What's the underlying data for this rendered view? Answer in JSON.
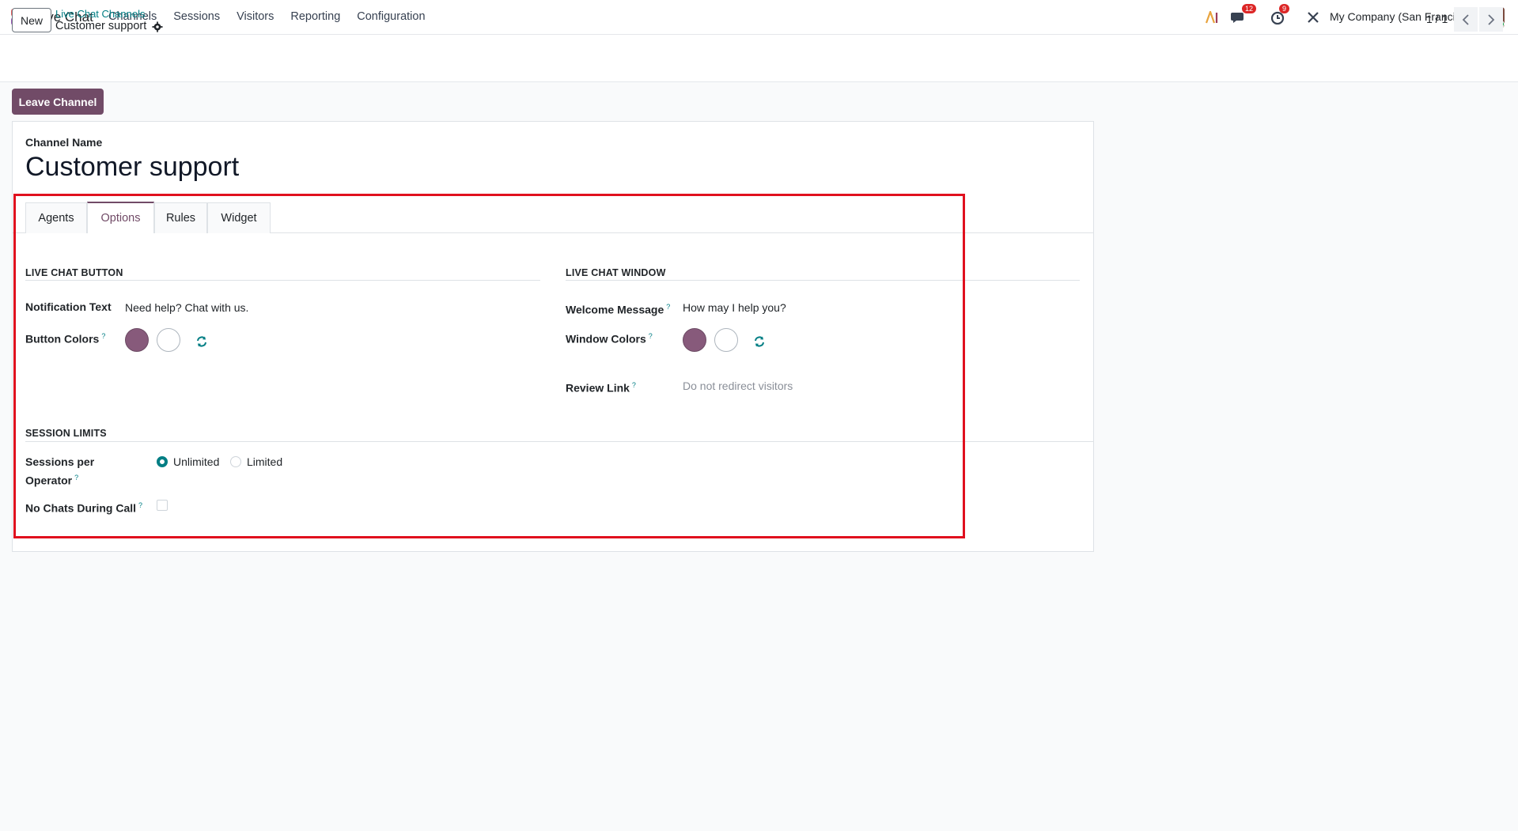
{
  "navbar": {
    "app_name": "Live Chat",
    "menu": [
      "Channels",
      "Sessions",
      "Visitors",
      "Reporting",
      "Configuration"
    ],
    "messages_badge": "12",
    "activities_badge": "9",
    "company": "My Company (San Francisco)"
  },
  "control": {
    "new_label": "New",
    "breadcrumb": "Live Chat Channels",
    "record_title": "Customer support",
    "pager": "1 / 1"
  },
  "actions": {
    "leave_label": "Leave Channel"
  },
  "form": {
    "channel_name_label": "Channel Name",
    "channel_name": "Customer support",
    "tabs": [
      "Agents",
      "Options",
      "Rules",
      "Widget"
    ],
    "active_tab": "Options",
    "button_section": {
      "title": "LIVE CHAT BUTTON",
      "notification_label": "Notification Text",
      "notification_value": "Need help? Chat with us.",
      "colors_label": "Button Colors",
      "help_mark": "?"
    },
    "window_section": {
      "title": "LIVE CHAT WINDOW",
      "welcome_label": "Welcome Message",
      "welcome_value": "How may I help you?",
      "colors_label": "Window Colors",
      "review_label": "Review Link",
      "review_placeholder": "Do not redirect visitors",
      "help_mark": "?"
    },
    "session_section": {
      "title": "SESSION LIMITS",
      "sessions_label_1": "Sessions per",
      "sessions_label_2": "Operator",
      "option_unlimited": "Unlimited",
      "option_limited": "Limited",
      "selected": "Unlimited",
      "no_chats_label": "No Chats During Call",
      "no_chats_checked": false,
      "help_mark": "?"
    },
    "colors": {
      "primary": "#875a7b",
      "secondary": "#ffffff"
    }
  }
}
